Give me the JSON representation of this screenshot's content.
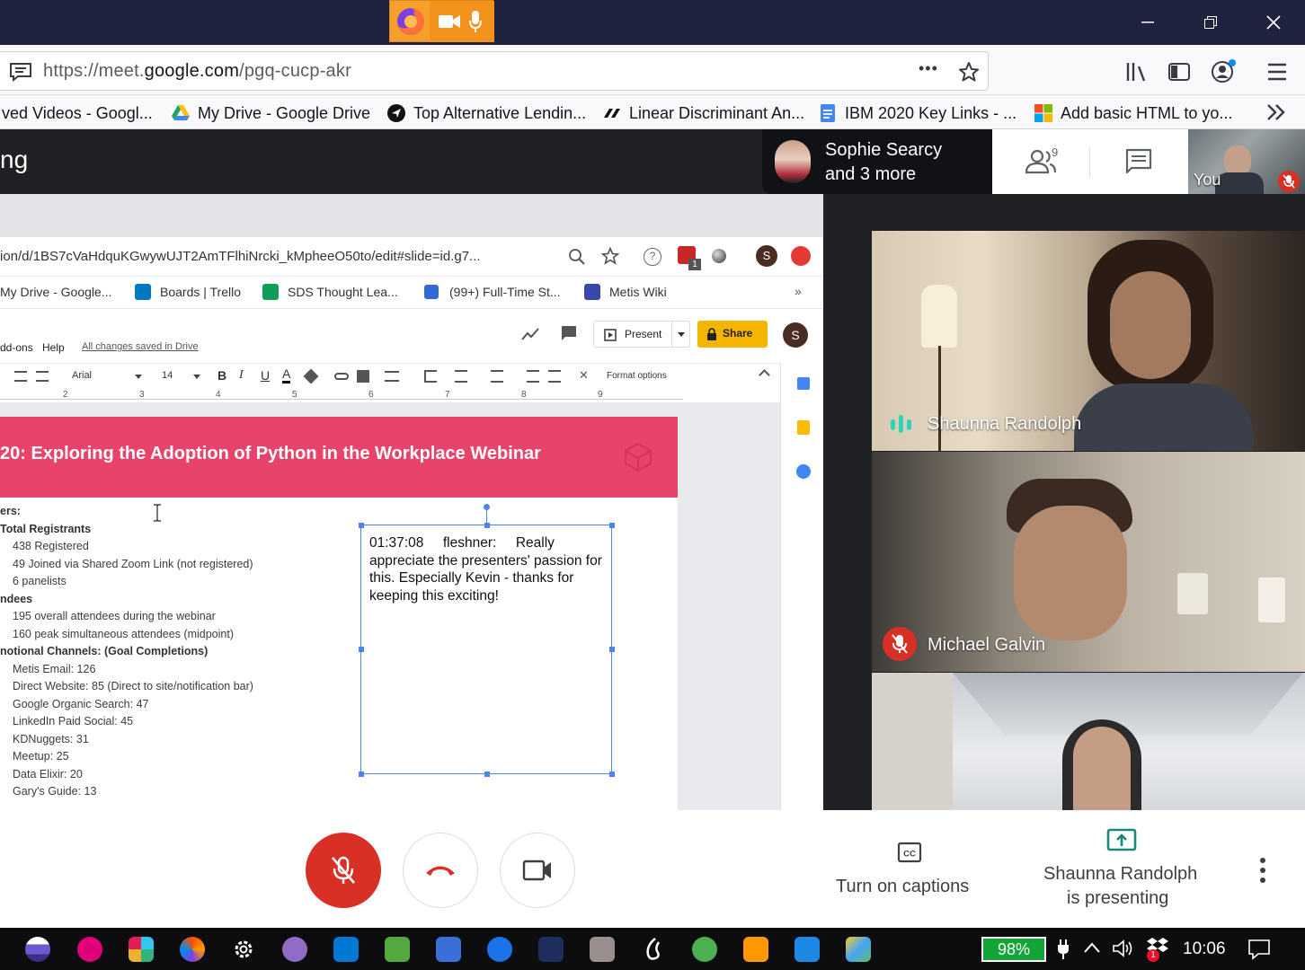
{
  "browser": {
    "url_prefix": "https://meet.",
    "url_domain": "google.com",
    "url_path": "/pgq-cucp-akr",
    "more_label": "•••"
  },
  "bookmarks": [
    {
      "label": "ved Videos - Googl..."
    },
    {
      "label": "My Drive - Google Drive"
    },
    {
      "label": "Top Alternative Lendin..."
    },
    {
      "label": "Linear Discriminant An..."
    },
    {
      "label": "IBM 2020 Key Links - ..."
    },
    {
      "label": "Add basic HTML to yo..."
    }
  ],
  "meet": {
    "title": "ng",
    "presenter_chip_line1": "Sophie Searcy",
    "presenter_chip_line2": "and 3 more",
    "people_count": "9",
    "self_label": "You"
  },
  "inner_browser": {
    "url": "ion/d/1BS7cVaHdquKGwywUJT2AmTFlhiNrcki_kMpheeO50to/edit#slide=id.g7...",
    "badge": "1",
    "avatar": "S",
    "bookmarks": [
      "My Drive - Google...",
      "Boards | Trello",
      "SDS Thought Lea...",
      "(99+) Full-Time St...",
      "Metis Wiki"
    ],
    "menu": [
      "dd-ons",
      "Help"
    ],
    "saved_status": "All changes saved in Drive",
    "present_label": "Present",
    "share_label": "Share",
    "font_name": "Arial",
    "font_size": "14",
    "format_options": "Format options",
    "ruler": [
      "2",
      "3",
      "4",
      "5",
      "6",
      "7",
      "8",
      "9"
    ]
  },
  "slide": {
    "title": "20: Exploring the Adoption of Python in the Workplace Webinar",
    "lines": [
      {
        "text": "ers:",
        "bold": true
      },
      {
        "text": "Total Registrants",
        "bold": true
      },
      {
        "text": "438 Registered",
        "bold": false
      },
      {
        "text": "49 Joined via Shared Zoom Link (not registered)",
        "bold": false
      },
      {
        "text": "6 panelists",
        "bold": false
      },
      {
        "text": "ndees",
        "bold": true
      },
      {
        "text": "195 overall attendees during the webinar",
        "bold": false
      },
      {
        "text": "160 peak simultaneous attendees (midpoint)",
        "bold": false
      },
      {
        "text": "notional Channels: (Goal Completions)",
        "bold": true
      },
      {
        "text": "Metis Email: 126",
        "bold": false
      },
      {
        "text": "Direct Website: 85 (Direct to site/notification bar)",
        "bold": false
      },
      {
        "text": "Google Organic Search: 47",
        "bold": false
      },
      {
        "text": "LinkedIn Paid Social: 45",
        "bold": false
      },
      {
        "text": "KDNuggets: 31",
        "bold": false
      },
      {
        "text": "Meetup: 25",
        "bold": false
      },
      {
        "text": "Data Elixir: 20",
        "bold": false
      },
      {
        "text": "Gary's Guide: 13",
        "bold": false
      }
    ],
    "textbox": "01:37:08     fleshner:     Really appreciate the presenters' passion for this. Especially Kevin - thanks for keeping this exciting!"
  },
  "participants": [
    {
      "name": "Shaunna Randolph",
      "status": "speaking"
    },
    {
      "name": "Michael Galvin",
      "status": "muted"
    },
    {
      "name": "",
      "status": "video"
    }
  ],
  "controls": {
    "captions_label": "Turn on captions",
    "presenting_line1": "Shaunna Randolph",
    "presenting_line2": "is presenting",
    "mic_color": "#d93025",
    "hangup_color": "#d93025"
  },
  "taskbar": {
    "battery": "98%",
    "time": "10:06",
    "notification_badge": "1"
  }
}
